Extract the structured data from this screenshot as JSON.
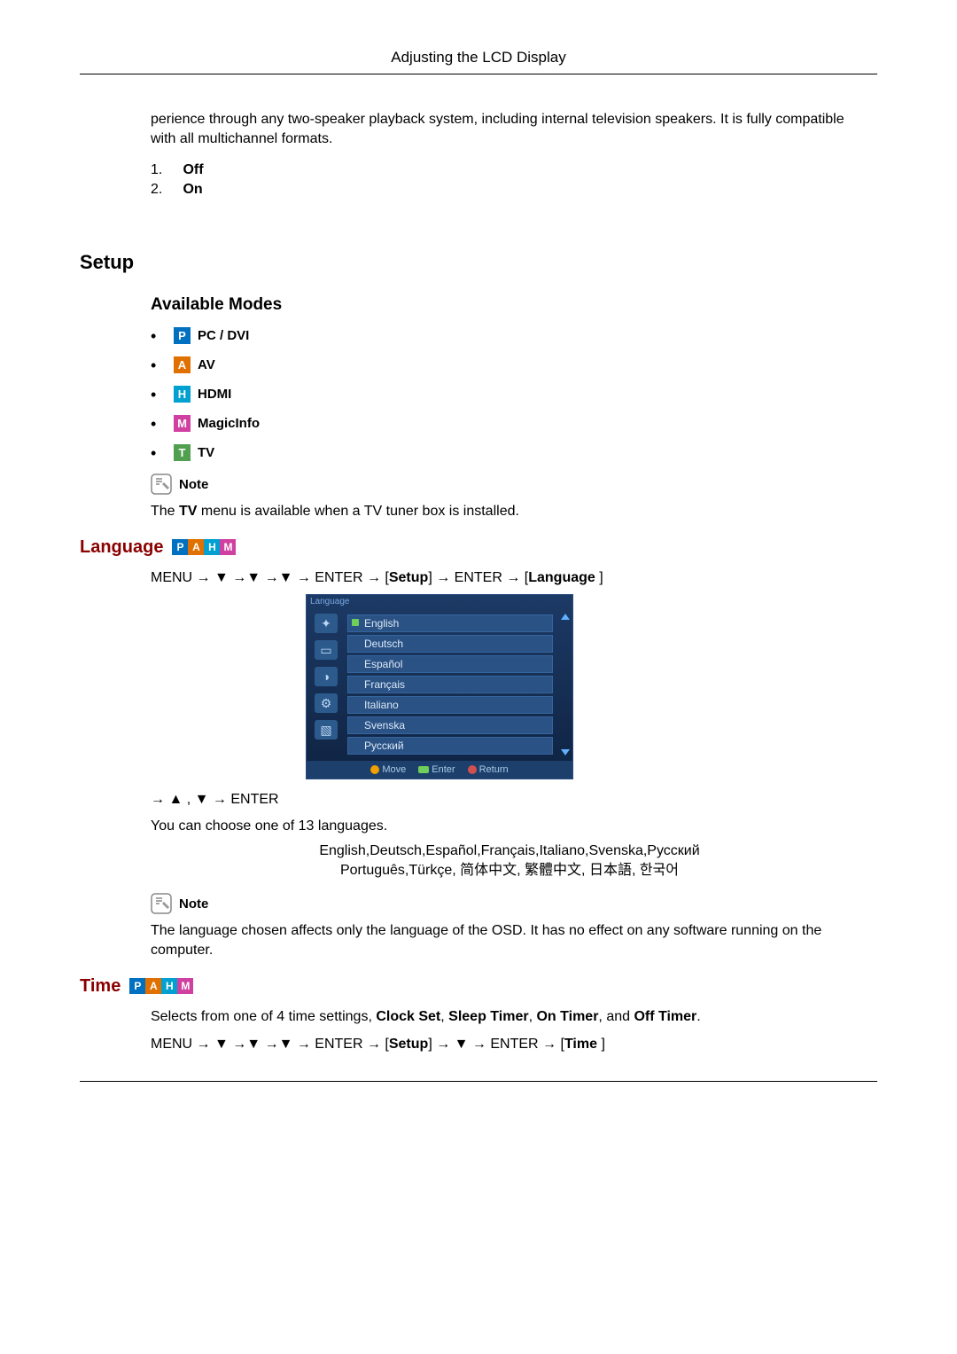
{
  "header": {
    "title": "Adjusting the LCD Display"
  },
  "intro": {
    "paragraph": "perience through any two-speaker playback system, including internal television speakers. It is fully compatible with all multichannel formats.",
    "options": [
      {
        "num": "1.",
        "label": "Off"
      },
      {
        "num": "2.",
        "label": "On"
      }
    ]
  },
  "setup": {
    "heading": "Setup",
    "available_modes_heading": "Available Modes",
    "modes": [
      {
        "letter": "P",
        "label": "PC / DVI"
      },
      {
        "letter": "A",
        "label": "AV"
      },
      {
        "letter": "H",
        "label": "HDMI"
      },
      {
        "letter": "M",
        "label": "MagicInfo"
      },
      {
        "letter": "T",
        "label": "TV"
      }
    ],
    "note_label": "Note",
    "note_text_pre": "The ",
    "note_text_bold": "TV",
    "note_text_post": " menu is available when a TV tuner box is installed."
  },
  "language": {
    "heading": "Language",
    "badges": [
      "P",
      "A",
      "H",
      "M"
    ],
    "nav1_pre": "MENU → ▼ →▼ →▼ → ENTER → [",
    "nav1_b1": "Setup",
    "nav1_mid": "] → ENTER → [",
    "nav1_b2": "Language",
    "nav1_post": " ]",
    "osd": {
      "title": "Language",
      "items": [
        "English",
        "Deutsch",
        "Español",
        "Français",
        "Italiano",
        "Svenska",
        "Русский"
      ],
      "footer": {
        "move": "Move",
        "enter": "Enter",
        "ret": "Return"
      }
    },
    "nav2": "→ ▲ , ▼ → ENTER",
    "desc": "You can choose one of 13 languages.",
    "languages_line1": "English,Deutsch,Español,Français,Italiano,Svenska,Русский",
    "languages_line2": "Português,Türkçe, 简体中文,  繁體中文, 日本語, 한국어",
    "note_label": "Note",
    "note_text": "The language chosen affects only the language of the OSD. It has no effect on any software running on the computer."
  },
  "time": {
    "heading": "Time",
    "badges": [
      "P",
      "A",
      "H",
      "M"
    ],
    "desc_pre": "Selects from one of 4 time settings, ",
    "b1": "Clock Set",
    "s1": ", ",
    "b2": "Sleep Timer",
    "s2": ", ",
    "b3": "On Timer",
    "s3": ", and ",
    "b4": "Off Timer",
    "post": ".",
    "nav_pre": "MENU → ▼ →▼ →▼ → ENTER → [",
    "nav_b1": "Setup",
    "nav_mid": "] → ▼ → ENTER → [",
    "nav_b2": "Time",
    "nav_post": " ]"
  }
}
